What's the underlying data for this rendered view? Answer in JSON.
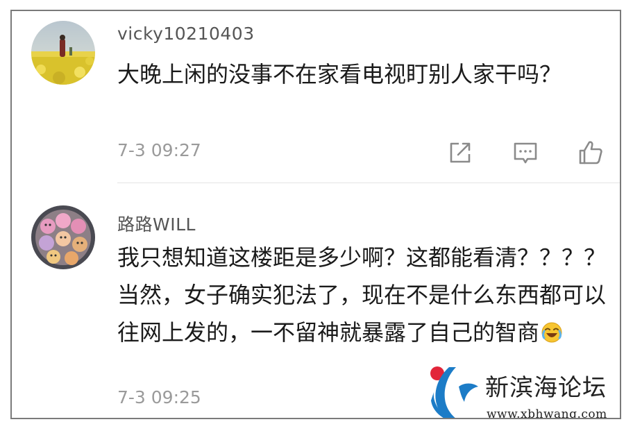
{
  "comments": [
    {
      "username": "vicky10210403",
      "text": "大晚上闲的没事不在家看电视盯别人家干吗？",
      "timestamp": "7-3 09:27",
      "avatar_icon": "rapeseed-field-photo-avatar"
    },
    {
      "username": "路路WILL",
      "text": "我只想知道这楼距是多少啊？这都能看清？？？？当然，女子确实犯法了，现在不是什么东西都可以往网上发的，一不留神就暴露了自己的智商",
      "emoji_icon": "crying-laughing-emoji-icon",
      "timestamp": "7-3 09:25",
      "avatar_icon": "cupcakes-photo-avatar"
    }
  ],
  "actions": {
    "share_icon": "share-icon",
    "reply_icon": "reply-comment-icon",
    "like_icon": "thumbs-up-icon"
  },
  "watermark": {
    "title": "新滨海论坛",
    "url": "www.xbhwang.com"
  },
  "colors": {
    "username": "#555555",
    "text": "#1a1a1a",
    "timestamp": "#9a9a9a",
    "icon": "#8a8a8a",
    "logo_red": "#e2253a",
    "logo_blue": "#1c7cc7"
  }
}
